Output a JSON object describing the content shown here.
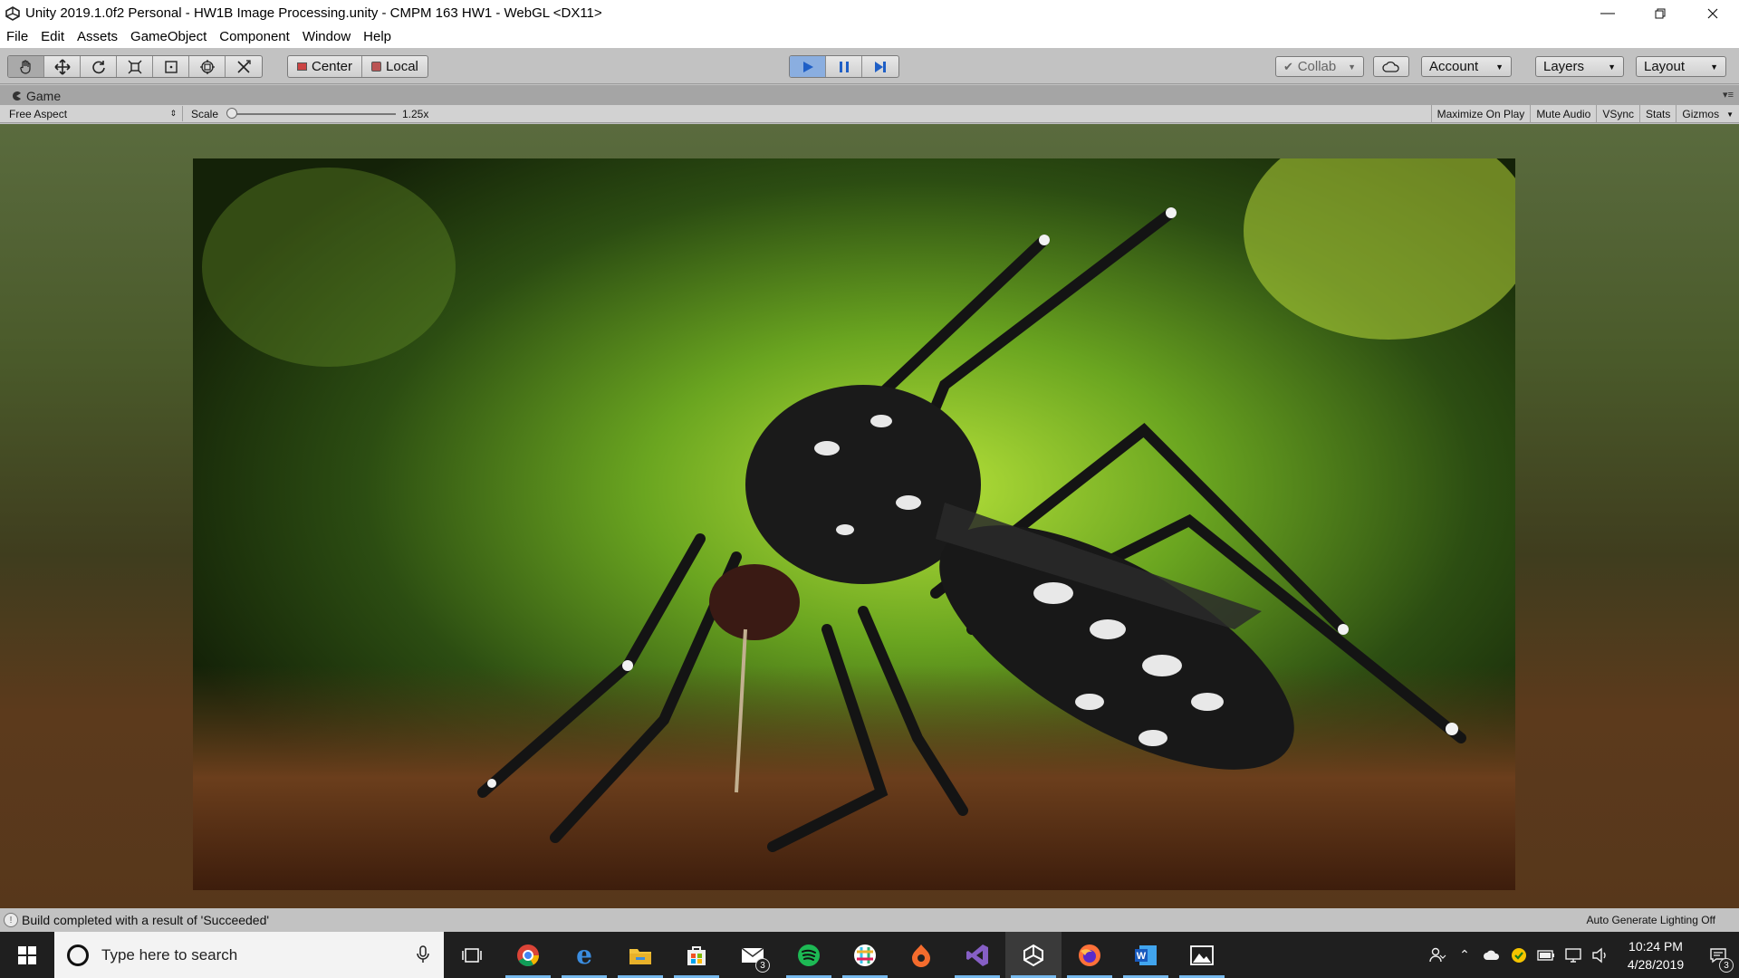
{
  "window": {
    "title": "Unity 2019.1.0f2 Personal - HW1B Image Processing.unity - CMPM 163 HW1 - WebGL <DX11>",
    "minimize_icon": "minimize-icon",
    "maximize_icon": "restore-icon",
    "close_icon": "close-icon"
  },
  "menu": [
    "File",
    "Edit",
    "Assets",
    "GameObject",
    "Component",
    "Window",
    "Help"
  ],
  "toolbar": {
    "tools": [
      "hand-tool-icon",
      "move-tool-icon",
      "rotate-tool-icon",
      "scale-tool-icon",
      "rect-tool-icon",
      "transform-tool-icon",
      "custom-tool-icon"
    ],
    "pivot": "Center",
    "space": "Local",
    "collab": "Collab",
    "account": "Account",
    "layers": "Layers",
    "layout": "Layout"
  },
  "game_panel": {
    "tab_label": "Game",
    "aspect": "Free Aspect",
    "scale_label": "Scale",
    "scale_value": "1.25x",
    "scale_fraction": 0.0,
    "options": [
      "Maximize On Play",
      "Mute Audio",
      "VSync",
      "Stats",
      "Gizmos"
    ]
  },
  "status": {
    "message": "Build completed with a result of 'Succeeded'",
    "lighting": "Auto Generate Lighting Off"
  },
  "taskbar": {
    "search_placeholder": "Type here to search",
    "apps": [
      "task-view-icon",
      "chrome-icon",
      "edge-icon",
      "file-explorer-icon",
      "store-icon",
      "mail-icon",
      "spotify-icon",
      "slack-icon",
      "origin-icon",
      "visual-studio-icon",
      "unity-icon",
      "firefox-icon",
      "word-icon",
      "photos-icon"
    ],
    "mail_badge": "3",
    "time": "10:24 PM",
    "date": "4/28/2019",
    "notification_badge": "3"
  },
  "colors": {
    "unity_bg": "#c2c2c2",
    "play_active": "#8aaee0",
    "taskbar": "#1f1f1f",
    "accent_blue": "#1f5fc6"
  }
}
